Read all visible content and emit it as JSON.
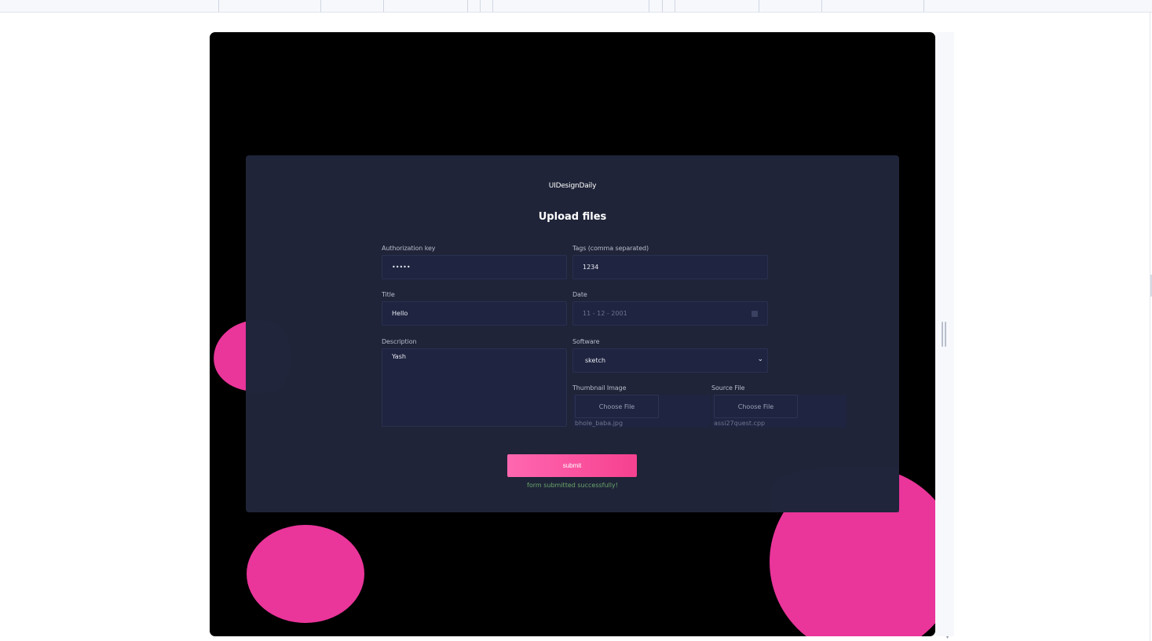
{
  "app": {
    "brand": "UIDesignDaily",
    "page_title": "Upload files"
  },
  "form": {
    "auth_label": "Authorization key",
    "auth_value": "•••••",
    "tags_label": "Tags (comma separated)",
    "tags_value": "1234",
    "title_label": "Title",
    "title_value": "Hello",
    "date_label": "Date",
    "date_value": "11 - 12 - 2001",
    "description_label": "Description",
    "description_value": "Yash",
    "software_label": "Software",
    "software_selected": "sketch",
    "thumbnail_label": "Thumbnail Image",
    "thumbnail_button": "Choose File",
    "thumbnail_filename": "bhole_baba.jpg",
    "source_label": "Source File",
    "source_button": "Choose File",
    "source_filename": "assi27quest.cpp",
    "submit_label": "submit",
    "success_message": "form submitted successfully!"
  },
  "icons": {
    "calendar": "calendar-icon",
    "dropdown": "chevron-down-icon",
    "resize": "resize-handle-icon"
  },
  "colors": {
    "accent_pink": "#ea359a",
    "card_bg": "#1f2438",
    "stage_bg": "#000000",
    "success_text": "#6aa56a",
    "button_gradient_start": "#ff67b1",
    "button_gradient_end": "#f6418f"
  }
}
